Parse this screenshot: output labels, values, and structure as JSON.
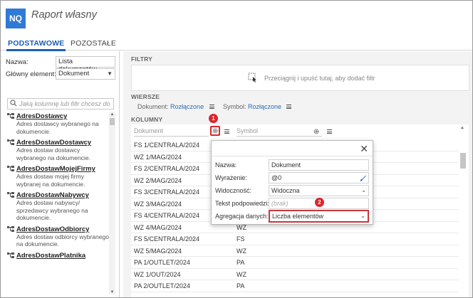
{
  "app": {
    "logo": "NQ",
    "title": "Raport własny"
  },
  "tabs": [
    {
      "label": "PODSTAWOWE",
      "active": true
    },
    {
      "label": "POZOSTAŁE",
      "active": false
    }
  ],
  "left": {
    "name_label": "Nazwa:",
    "name_value": "Lista dokumentów",
    "main_label": "Główny element:",
    "main_value": "Dokument",
    "search_placeholder": "Jaką kolumnę lub filtr chcesz do",
    "items": [
      {
        "name": "AdresDostawcy",
        "desc": "Adres dostawcy wybranego na dokumencie."
      },
      {
        "name": "AdresDostawDostawcy",
        "desc": "Adres dostaw dostawcy wybranego na dokumencie."
      },
      {
        "name": "AdresDostawMojejFirmy",
        "desc": "Adres dostaw mojej firmy wybranej na dokumencie."
      },
      {
        "name": "AdresDostawNabywcy",
        "desc": "Adres dostaw nabywcy/ sprzedawcy wybranego na dokumencie."
      },
      {
        "name": "AdresDostawOdbiorcy",
        "desc": "Adres dostaw odbiorcy wybranego na dokumencie."
      },
      {
        "name": "AdresDostawPlatnika",
        "desc": ""
      }
    ]
  },
  "right": {
    "filters_title": "FILTRY",
    "drop_text": "Przeciągnij i upuść tutaj, aby dodać filtr",
    "rows_title": "WIERSZE",
    "rows_chips": [
      {
        "label": "Dokument:",
        "value": "Rozłączone"
      },
      {
        "label": "Symbol:",
        "value": "Rozłączone"
      }
    ],
    "columns_title": "KOLUMNY",
    "col_headers": [
      "Dokument",
      "Symbol"
    ],
    "data_rows": [
      [
        "FS 1/CENTRALA/2024",
        ""
      ],
      [
        "WZ 1/MAG/2024",
        ""
      ],
      [
        "FS 2/CENTRALA/2024",
        ""
      ],
      [
        "WZ 2/MAG/2024",
        ""
      ],
      [
        "FS 3/CENTRALA/2024",
        ""
      ],
      [
        "WZ 3/MAG/2024",
        ""
      ],
      [
        "FS 4/CENTRALA/2024",
        ""
      ],
      [
        "WZ 4/MAG/2024",
        "WZ"
      ],
      [
        "FS 5/CENTRALA/2024",
        "FS"
      ],
      [
        "WZ 5/MAG/2024",
        "WZ"
      ],
      [
        "PA 1/OUTLET/2024",
        "PA"
      ],
      [
        "WZ 1/OUT/2024",
        "WZ"
      ],
      [
        "PA 2/OUTLET/2024",
        "PA"
      ]
    ]
  },
  "dialog": {
    "close_label": "✕",
    "fields": [
      {
        "label": "Nazwa:",
        "value": "Dokument"
      },
      {
        "label": "Wyrażenie:",
        "value": "@0"
      },
      {
        "label": "Widoczność:",
        "value": "Widoczna"
      },
      {
        "label": "Tekst podpowiedzi:",
        "value": "(brak)"
      },
      {
        "label": "Agregacja danych:",
        "value": "Liczba elementów"
      }
    ]
  },
  "badges": [
    "1",
    "2"
  ],
  "colors": {
    "accent": "#1a5fb4",
    "logo": "#2e7ad6",
    "marker": "#d9262c"
  }
}
